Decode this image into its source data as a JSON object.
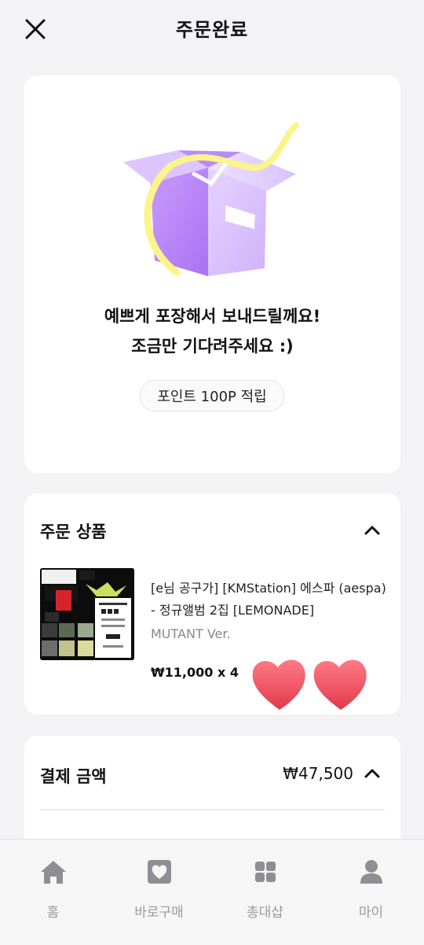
{
  "header": {
    "title": "주문완료",
    "close_icon": "close-icon"
  },
  "hero": {
    "illustration": "gift-box-illustration",
    "message_line1": "예쁘게 포장해서 보내드릴께요!",
    "message_line2": "조금만 기다려주세요 :)",
    "point_badge": "포인트 100P 적립"
  },
  "order_items": {
    "title": "주문 상품",
    "expanded": true,
    "items": [
      {
        "name": "[e님 공구가] [KMStation] 에스파 (aespa) - 정규앨범 2집 [LEMONADE]",
        "option": "MUTANT Ver.",
        "price": "₩11,000 x 4"
      }
    ]
  },
  "payment": {
    "title": "결제 금액",
    "amount": "₩47,500",
    "expanded": true
  },
  "tabbar": {
    "tabs": [
      {
        "label": "홈",
        "icon": "home-icon"
      },
      {
        "label": "바로구매",
        "icon": "heart-square-icon"
      },
      {
        "label": "총대샵",
        "icon": "grid-icon"
      },
      {
        "label": "마이",
        "icon": "person-icon"
      }
    ]
  },
  "colors": {
    "accent_purple": "#c9a6ff",
    "ribbon_yellow": "#fbf48a",
    "heart_red": "#f0505f",
    "background": "#f3f3f5"
  }
}
